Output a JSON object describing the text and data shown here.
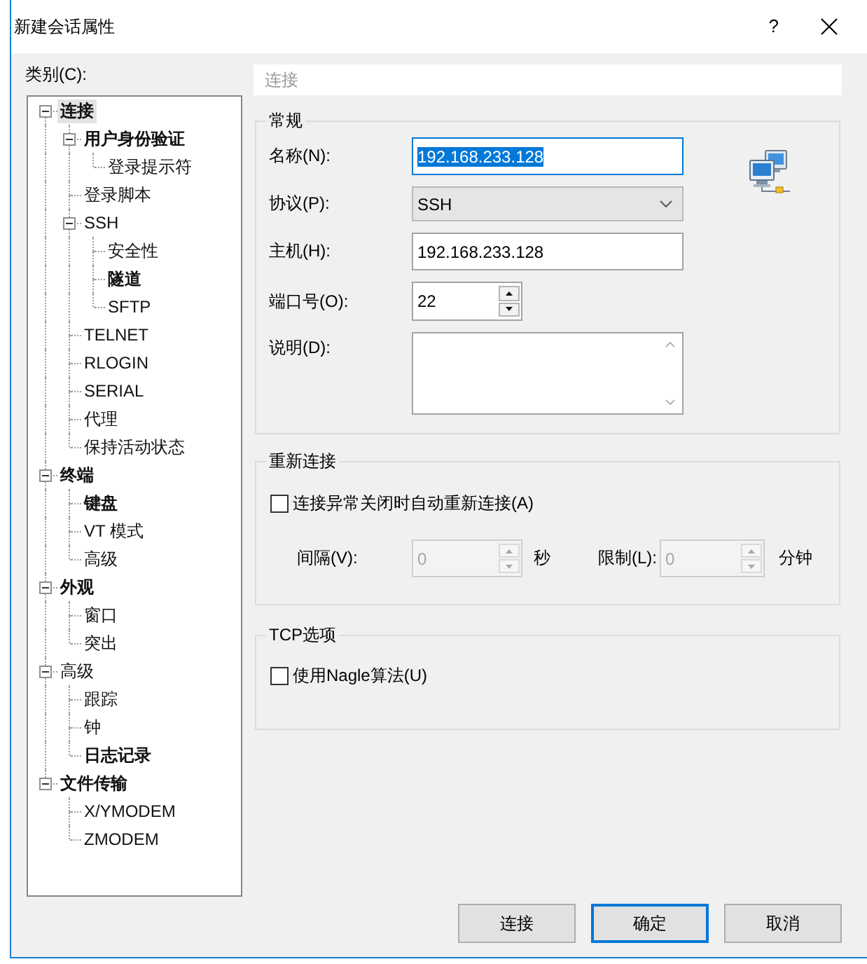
{
  "window": {
    "title": "新建会话属性",
    "help": "?"
  },
  "category_label": "类别(C):",
  "tree": [
    {
      "label": "连接",
      "selected": true,
      "emphasized": true,
      "expanded": true,
      "children": [
        {
          "label": "用户身份验证",
          "selected": false,
          "emphasized": true,
          "expanded": true,
          "children": [
            {
              "label": "登录提示符",
              "selected": false,
              "emphasized": false
            }
          ]
        },
        {
          "label": "登录脚本",
          "selected": false,
          "emphasized": false
        },
        {
          "label": "SSH",
          "selected": false,
          "emphasized": false,
          "expanded": true,
          "children": [
            {
              "label": "安全性",
              "selected": false,
              "emphasized": false
            },
            {
              "label": "隧道",
              "selected": false,
              "emphasized": true
            },
            {
              "label": "SFTP",
              "selected": false,
              "emphasized": false
            }
          ]
        },
        {
          "label": "TELNET",
          "selected": false,
          "emphasized": false
        },
        {
          "label": "RLOGIN",
          "selected": false,
          "emphasized": false
        },
        {
          "label": "SERIAL",
          "selected": false,
          "emphasized": false
        },
        {
          "label": "代理",
          "selected": false,
          "emphasized": false
        },
        {
          "label": "保持活动状态",
          "selected": false,
          "emphasized": false
        }
      ]
    },
    {
      "label": "终端",
      "selected": false,
      "emphasized": true,
      "expanded": true,
      "children": [
        {
          "label": "键盘",
          "selected": false,
          "emphasized": true
        },
        {
          "label": "VT 模式",
          "selected": false,
          "emphasized": false
        },
        {
          "label": "高级",
          "selected": false,
          "emphasized": false
        }
      ]
    },
    {
      "label": "外观",
      "selected": false,
      "emphasized": true,
      "expanded": true,
      "children": [
        {
          "label": "窗口",
          "selected": false,
          "emphasized": false
        },
        {
          "label": "突出",
          "selected": false,
          "emphasized": false
        }
      ]
    },
    {
      "label": "高级",
      "selected": false,
      "emphasized": false,
      "expanded": true,
      "children": [
        {
          "label": "跟踪",
          "selected": false,
          "emphasized": false
        },
        {
          "label": "钟",
          "selected": false,
          "emphasized": false
        },
        {
          "label": "日志记录",
          "selected": false,
          "emphasized": true
        }
      ]
    },
    {
      "label": "文件传输",
      "selected": false,
      "emphasized": true,
      "expanded": true,
      "children": [
        {
          "label": "X/YMODEM",
          "selected": false,
          "emphasized": false
        },
        {
          "label": "ZMODEM",
          "selected": false,
          "emphasized": false
        }
      ]
    }
  ],
  "panel": {
    "header": "连接",
    "general": {
      "legend": "常规",
      "fields": [
        {
          "kind": "text",
          "label": "名称(N):",
          "value": "192.168.233.128",
          "focused": true
        },
        {
          "kind": "select",
          "label": "协议(P):",
          "value": "SSH"
        },
        {
          "kind": "text",
          "label": "主机(H):",
          "value": "192.168.233.128",
          "focused": false
        },
        {
          "kind": "spin",
          "label": "端口号(O):",
          "value": "22",
          "disabled": false
        },
        {
          "kind": "textarea",
          "label": "说明(D):"
        }
      ]
    },
    "reconnect": {
      "legend": "重新连接",
      "checkbox": {
        "label": "连接异常关闭时自动重新连接(A)",
        "checked": false
      },
      "spins": [
        {
          "label": "间隔(V):",
          "value": "0",
          "unit": "秒",
          "disabled": true
        },
        {
          "label": "限制(L):",
          "value": "0",
          "unit": "分钟",
          "disabled": true
        }
      ]
    },
    "tcp": {
      "legend": "TCP选项",
      "checkbox": {
        "label": "使用Nagle算法(U)",
        "checked": false
      }
    }
  },
  "buttons": [
    {
      "label": "连接",
      "default": false
    },
    {
      "label": "确定",
      "default": true
    },
    {
      "label": "取消",
      "default": false
    }
  ]
}
